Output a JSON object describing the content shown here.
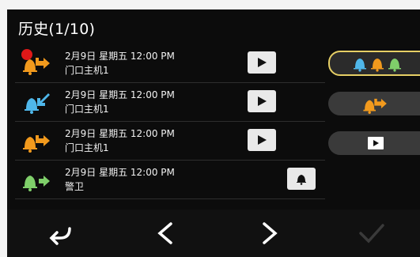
{
  "header": {
    "title": "历史(1/10)"
  },
  "colors": {
    "blue": "#4fb7ea",
    "orange": "#f29a1d",
    "green": "#7fcf6a",
    "highlight": "#e6cf65",
    "unread": "#e01818"
  },
  "records": [
    {
      "date": "2月9日 星期五 12:00 PM",
      "source": "门口主机1",
      "icon": "outgoing-call-orange-icon",
      "unread": true,
      "action": "play-icon"
    },
    {
      "date": "2月9日 星期五 12:00 PM",
      "source": "门口主机1",
      "icon": "incoming-call-blue-icon",
      "unread": false,
      "action": "play-icon"
    },
    {
      "date": "2月9日 星期五 12:00 PM",
      "source": "门口主机1",
      "icon": "outgoing-call-orange-icon",
      "unread": false,
      "action": "play-icon"
    },
    {
      "date": "2月9日 星期五 12:00 PM",
      "source": "警卫",
      "icon": "outgoing-call-green-icon",
      "unread": false,
      "action": "bell-icon"
    }
  ],
  "side_filters": [
    {
      "name": "filter-all-calls",
      "icon": "three-bells-icon",
      "active": true
    },
    {
      "name": "filter-outgoing",
      "icon": "outgoing-call-icon",
      "active": false
    },
    {
      "name": "filter-recordings",
      "icon": "play-icon",
      "active": false
    }
  ],
  "bottom_nav": [
    "back-icon",
    "previous-icon",
    "next-icon",
    "confirm-check-icon"
  ]
}
